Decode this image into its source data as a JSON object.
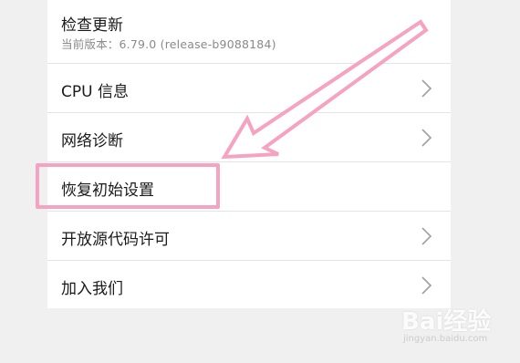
{
  "settings": {
    "items": [
      {
        "label": "检查更新",
        "sublabel": "当前版本：6.79.0   (release-b9088184)",
        "has_chevron": false
      },
      {
        "label": "CPU 信息",
        "has_chevron": true
      },
      {
        "label": "网络诊断",
        "has_chevron": true
      },
      {
        "label": "恢复初始设置",
        "has_chevron": false,
        "highlighted": true
      },
      {
        "label": "开放源代码许可",
        "has_chevron": true
      },
      {
        "label": "加入我们",
        "has_chevron": true
      }
    ]
  },
  "annotation": {
    "highlight_color": "#f5a3c0",
    "arrow_target": "恢复初始设置"
  },
  "watermark": {
    "logo": "Bai经验",
    "url": "jingyan.baidu.com"
  },
  "colors": {
    "background": "#f0f0f0",
    "panel": "#ffffff",
    "text": "#1a1a1a",
    "subtext": "#8a8a8a",
    "chevron": "#a0a0a0",
    "annotation": "#f5a3c0"
  }
}
